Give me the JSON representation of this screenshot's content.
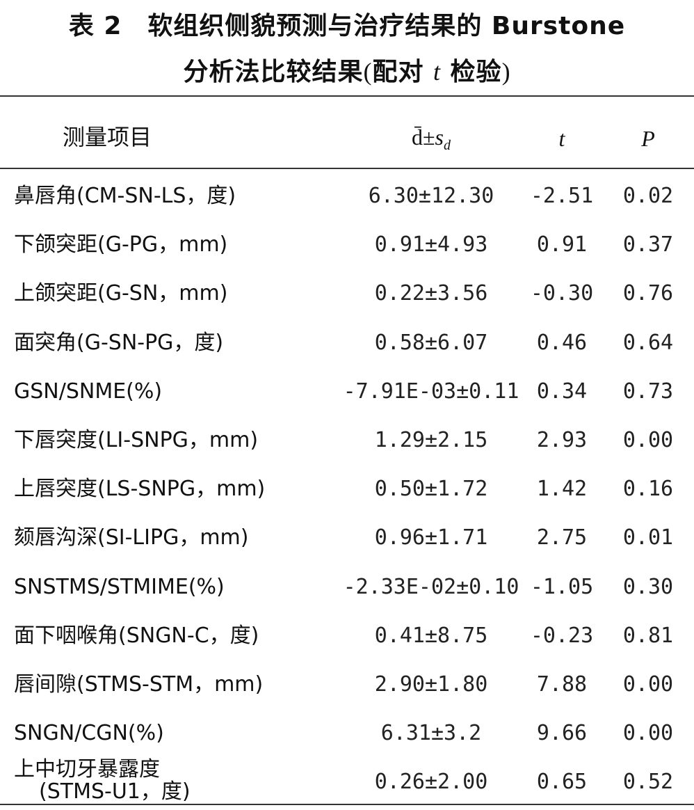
{
  "title": {
    "line1": "表 2　软组织侧貌预测与治疗结果的 Burstone",
    "line2_main": "分析法比较结果",
    "line2_paren_open": "(",
    "line2_paired": "配对 ",
    "line2_t": "t",
    "line2_test": " 检验",
    "line2_paren_close": ")"
  },
  "headers": {
    "item": "测量项目",
    "mean_sd": "d̄±",
    "mean_sd_sub": "s",
    "mean_sd_subsub": "d",
    "t": "t",
    "p": "P"
  },
  "rows": [
    {
      "item": "鼻唇角(CM-SN-LS，度)",
      "mean_sd": "6.30±12.30",
      "t": "-2.51",
      "p": "0.02"
    },
    {
      "item": "下颌突距(G-PG，mm)",
      "mean_sd": "0.91±4.93",
      "t": "0.91",
      "p": "0.37"
    },
    {
      "item": "上颌突距(G-SN，mm)",
      "mean_sd": "0.22±3.56",
      "t": "-0.30",
      "p": "0.76"
    },
    {
      "item": "面突角(G-SN-PG，度)",
      "mean_sd": "0.58±6.07",
      "t": "0.46",
      "p": "0.64"
    },
    {
      "item": "GSN/SNME(%)",
      "mean_sd": "-7.91E-03±0.11",
      "t": "0.34",
      "p": "0.73"
    },
    {
      "item": "下唇突度(LI-SNPG，mm)",
      "mean_sd": "1.29±2.15",
      "t": "2.93",
      "p": "0.00"
    },
    {
      "item": "上唇突度(LS-SNPG，mm)",
      "mean_sd": "0.50±1.72",
      "t": "1.42",
      "p": "0.16"
    },
    {
      "item": "颏唇沟深(SI-LIPG，mm)",
      "mean_sd": "0.96±1.71",
      "t": "2.75",
      "p": "0.01"
    },
    {
      "item": "SNSTMS/STMIME(%)",
      "mean_sd": "-2.33E-02±0.10",
      "t": "-1.05",
      "p": "0.30"
    },
    {
      "item": "面下咽喉角(SNGN-C，度)",
      "mean_sd": "0.41±8.75",
      "t": "-0.23",
      "p": "0.81"
    },
    {
      "item": "唇间隙(STMS-STM，mm)",
      "mean_sd": "2.90±1.80",
      "t": "7.88",
      "p": "0.00"
    },
    {
      "item": "SNGN/CGN(%)",
      "mean_sd": "6.31±3.2",
      "t": "9.66",
      "p": "0.00"
    },
    {
      "item": "上中切牙暴露度",
      "item_line2": "(STMS-U1，度)",
      "mean_sd": "0.26±2.00",
      "t": "0.65",
      "p": "0.52"
    }
  ]
}
